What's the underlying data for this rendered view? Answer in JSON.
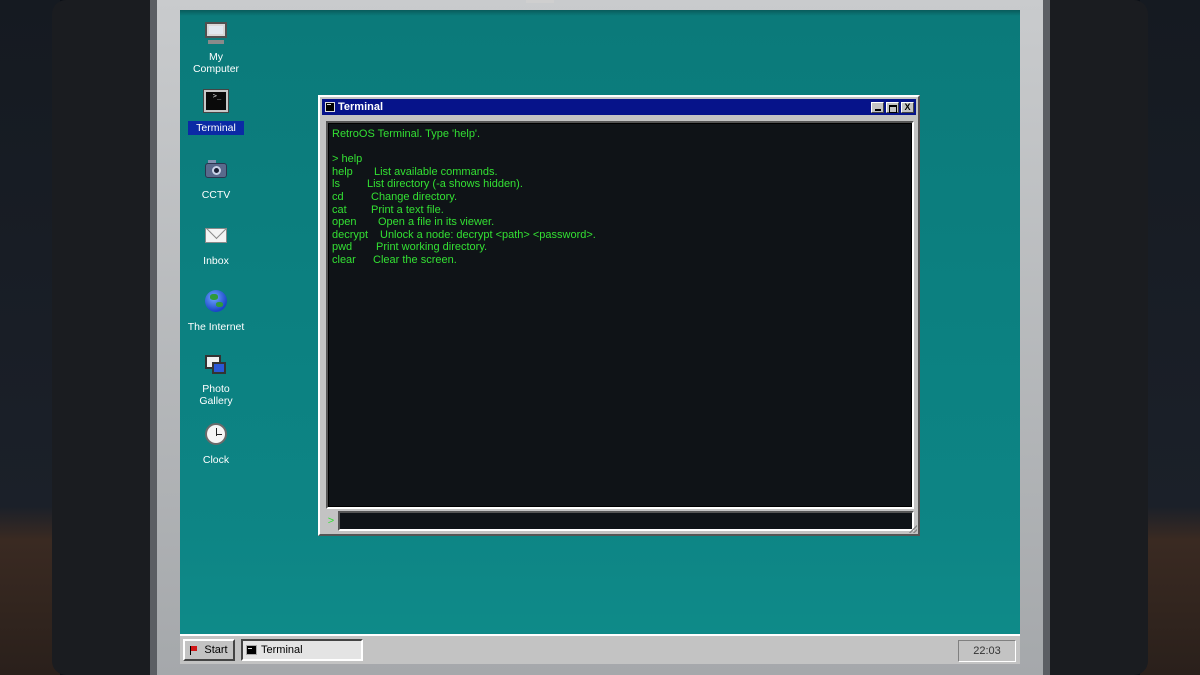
{
  "desktop": {
    "icons": [
      {
        "label": "My\nComputer",
        "icon": "computer-icon"
      },
      {
        "label": "Terminal",
        "icon": "terminal-icon",
        "selected": true
      },
      {
        "label": "CCTV",
        "icon": "camera-icon"
      },
      {
        "label": "Inbox",
        "icon": "envelope-icon"
      },
      {
        "label": "The Internet",
        "icon": "globe-icon"
      },
      {
        "label": "Photo\nGallery",
        "icon": "photos-icon"
      },
      {
        "label": "Clock",
        "icon": "clock-icon"
      }
    ]
  },
  "terminal": {
    "title": "Terminal",
    "controls": {
      "minimize": "",
      "maximize": "",
      "close": "X"
    },
    "output": {
      "welcome": "RetroOS Terminal. Type 'help'.",
      "blank": "",
      "command_echo": "> help",
      "commands": [
        {
          "name": "help",
          "desc": "List available commands."
        },
        {
          "name": "ls",
          "desc": "List directory (-a shows hidden)."
        },
        {
          "name": "cd",
          "desc": "Change directory."
        },
        {
          "name": "cat",
          "desc": "Print a text file."
        },
        {
          "name": "open",
          "desc": "Open a file in its viewer."
        },
        {
          "name": "decrypt",
          "desc": "Unlock a node: decrypt <path> <password>."
        },
        {
          "name": "pwd",
          "desc": "Print working directory."
        },
        {
          "name": "clear",
          "desc": "Clear the screen."
        }
      ]
    },
    "prompt": ">",
    "input_value": ""
  },
  "taskbar": {
    "start_label": "Start",
    "tasks": [
      {
        "label": "Terminal"
      }
    ],
    "clock": "22:03"
  },
  "colors": {
    "desktop_bg": "#0b7f7f",
    "title_bar": "#06138a",
    "terminal_text": "#33e033",
    "terminal_bg": "#0f1317",
    "selection": "#0b2aa5"
  }
}
